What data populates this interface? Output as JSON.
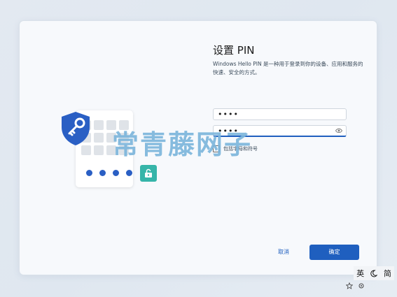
{
  "title": "设置 PIN",
  "description": "Windows Hello PIN 是一种用于登录到你的设备、应用和服务的快速、安全的方式。",
  "pin_field": {
    "value": "••••"
  },
  "confirm_field": {
    "value": "••••"
  },
  "checkbox_label": "包括字母和符号",
  "cancel_label": "取消",
  "ok_label": "确定",
  "watermark": "常青藤网子",
  "tray": {
    "ime_lang": "英",
    "ime_mode": "简"
  },
  "colors": {
    "accent": "#1f5fbf",
    "shield": "#2a5fc4",
    "lock_badge": "#36b5a9",
    "watermark": "#7db6dc"
  }
}
